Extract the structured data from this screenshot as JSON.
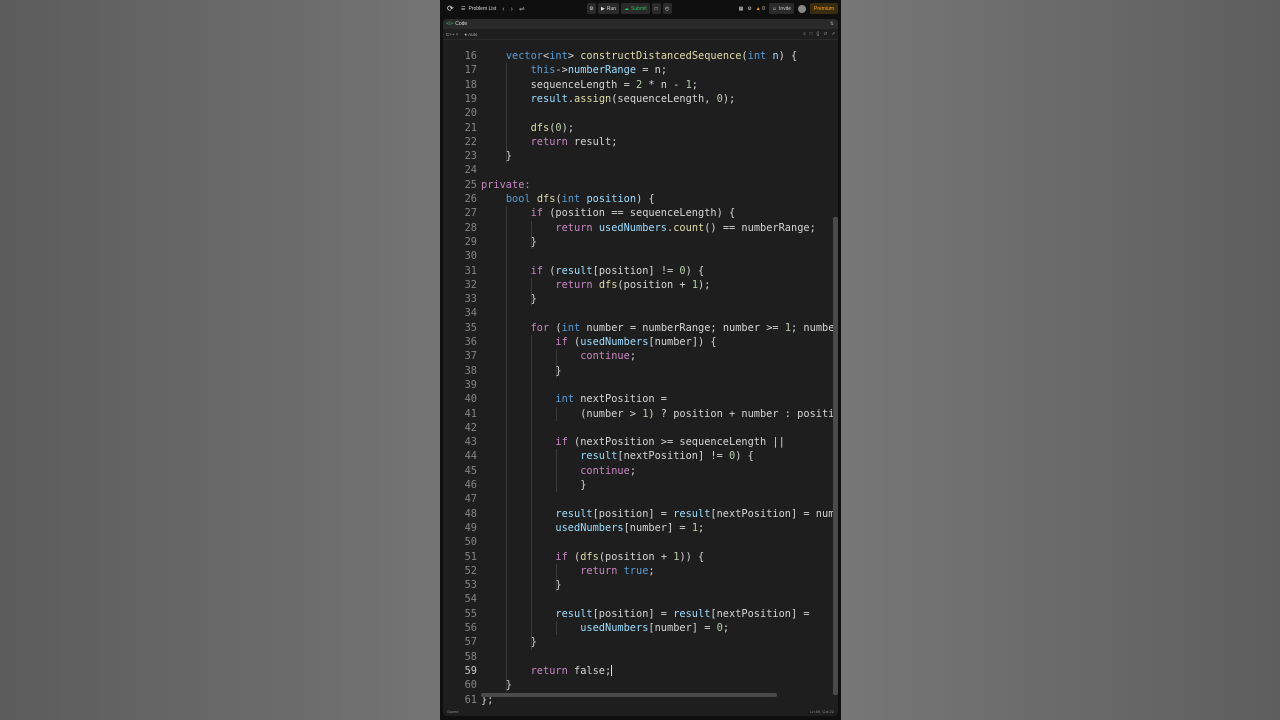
{
  "topbar": {
    "problem_list": "Problem List",
    "run": "Run",
    "submit": "Submit",
    "streak": "0",
    "invite": "Invite",
    "premium": "Premium"
  },
  "panel": {
    "title": "Code",
    "language": "C++",
    "autosave": "Auto"
  },
  "editor": {
    "active_line": 59,
    "lines": [
      {
        "n": "16",
        "html": "    <span class=\"t\">vector</span>&lt;<span class=\"t\">int</span>&gt; <span class=\"f\">constructDistancedSequence</span>(<span class=\"t\">int</span> <span class=\"v\">n</span>) {"
      },
      {
        "n": "17",
        "html": "        <span class=\"t\">this</span>-&gt;<span class=\"v\">numberRange</span> = n;"
      },
      {
        "n": "18",
        "html": "        sequenceLength = <span class=\"n\">2</span> * n - <span class=\"n\">1</span>;"
      },
      {
        "n": "19",
        "html": "        <span class=\"v\">result</span>.<span class=\"f\">assign</span>(sequenceLength, <span class=\"n\">0</span>);"
      },
      {
        "n": "20",
        "html": ""
      },
      {
        "n": "21",
        "html": "        <span class=\"f\">dfs</span>(<span class=\"n\">0</span>);"
      },
      {
        "n": "22",
        "html": "        <span class=\"k\">return</span> result;"
      },
      {
        "n": "23",
        "html": "    }"
      },
      {
        "n": "24",
        "html": ""
      },
      {
        "n": "25",
        "html": "<span class=\"k\">private:</span>"
      },
      {
        "n": "26",
        "html": "    <span class=\"t\">bool</span> <span class=\"f\">dfs</span>(<span class=\"t\">int</span> <span class=\"v\">position</span>) {"
      },
      {
        "n": "27",
        "html": "        <span class=\"k\">if</span> (position == sequenceLength) {"
      },
      {
        "n": "28",
        "html": "            <span class=\"k\">return</span> <span class=\"v\">usedNumbers</span>.<span class=\"f\">count</span>() == numberRange;"
      },
      {
        "n": "29",
        "html": "        }"
      },
      {
        "n": "30",
        "html": ""
      },
      {
        "n": "31",
        "html": "        <span class=\"k\">if</span> (<span class=\"v\">result</span>[position] != <span class=\"n\">0</span>) {"
      },
      {
        "n": "32",
        "html": "            <span class=\"k\">return</span> <span class=\"f\">dfs</span>(position + <span class=\"n\">1</span>);"
      },
      {
        "n": "33",
        "html": "        }"
      },
      {
        "n": "34",
        "html": ""
      },
      {
        "n": "35",
        "html": "        <span class=\"k\">for</span> (<span class=\"t\">int</span> number = numberRange; number &gt;= <span class=\"n\">1</span>; numbe"
      },
      {
        "n": "36",
        "html": "            <span class=\"k\">if</span> (<span class=\"v\">usedNumbers</span>[number]) {"
      },
      {
        "n": "37",
        "html": "                <span class=\"k\">continue</span>;"
      },
      {
        "n": "38",
        "html": "            }"
      },
      {
        "n": "39",
        "html": ""
      },
      {
        "n": "40",
        "html": "            <span class=\"t\">int</span> nextPosition ="
      },
      {
        "n": "41",
        "html": "                (number &gt; <span class=\"n\">1</span>) ? position + number : positi"
      },
      {
        "n": "42",
        "html": ""
      },
      {
        "n": "43",
        "html": "            <span class=\"k\">if</span> (nextPosition &gt;= sequenceLength ||"
      },
      {
        "n": "44",
        "html": "                <span class=\"v\">result</span>[nextPosition] != <span class=\"n\">0</span>) {"
      },
      {
        "n": "45",
        "html": "                <span class=\"k\">continue</span>;"
      },
      {
        "n": "46",
        "html": "                }"
      },
      {
        "n": "47",
        "html": ""
      },
      {
        "n": "48",
        "html": "            <span class=\"v\">result</span>[position] = <span class=\"v\">result</span>[nextPosition] = num"
      },
      {
        "n": "49",
        "html": "            <span class=\"v\">usedNumbers</span>[number] = <span class=\"n\">1</span>;"
      },
      {
        "n": "50",
        "html": ""
      },
      {
        "n": "51",
        "html": "            <span class=\"k\">if</span> (<span class=\"f\">dfs</span>(position + <span class=\"n\">1</span>)) {"
      },
      {
        "n": "52",
        "html": "                <span class=\"k\">return</span> <span class=\"t\">true</span>;"
      },
      {
        "n": "53",
        "html": "            }"
      },
      {
        "n": "54",
        "html": ""
      },
      {
        "n": "55",
        "html": "            <span class=\"v\">result</span>[position] = <span class=\"v\">result</span>[nextPosition] ="
      },
      {
        "n": "56",
        "html": "                <span class=\"v\">usedNumbers</span>[number] = <span class=\"n\">0</span>;"
      },
      {
        "n": "57",
        "html": "        }"
      },
      {
        "n": "58",
        "html": ""
      },
      {
        "n": "59",
        "html": "        <span class=\"k\">return</span> false;"
      },
      {
        "n": "60",
        "html": "    }"
      },
      {
        "n": "61",
        "html": "};"
      }
    ]
  },
  "status": {
    "left": "Saved",
    "position": "Ln 59, Col 22"
  }
}
